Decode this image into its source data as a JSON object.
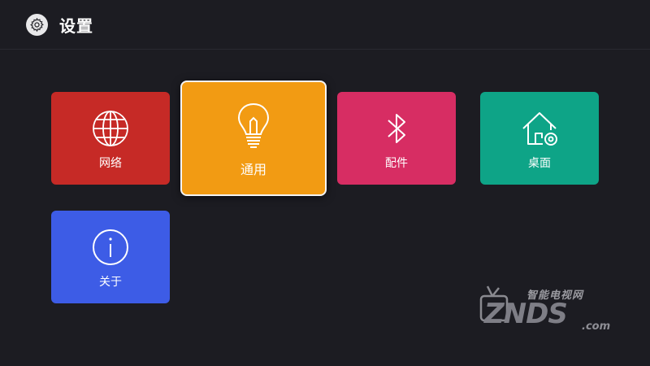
{
  "header": {
    "title": "设置",
    "icon": "gear-icon"
  },
  "tiles": [
    {
      "label": "网络",
      "icon": "globe-icon",
      "color": "#c62a26"
    },
    {
      "label": "通用",
      "icon": "lightbulb-icon",
      "color": "#f29b13",
      "focused": true
    },
    {
      "label": "配件",
      "icon": "bluetooth-icon",
      "color": "#d72d63"
    },
    {
      "label": "桌面",
      "icon": "home-settings-icon",
      "color": "#0ea487"
    },
    {
      "label": "关于",
      "icon": "info-icon",
      "color": "#3d5ce6"
    }
  ],
  "watermark": {
    "sub": "智能电视网",
    "main": "ZNDS",
    "suffix": ".com"
  },
  "colors": {
    "background": "#1c1c22"
  }
}
